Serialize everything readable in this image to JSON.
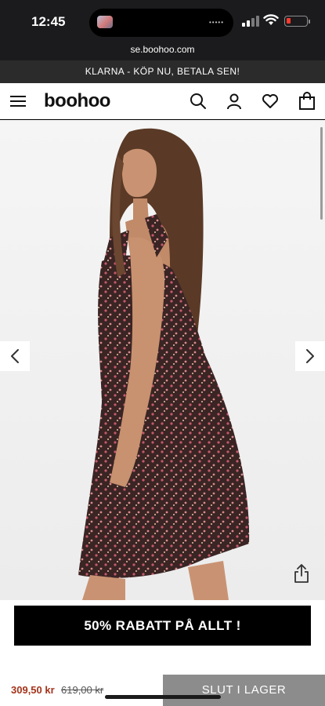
{
  "status_bar": {
    "time": "12:45",
    "island_dots": "•••••"
  },
  "browser": {
    "url": "se.boohoo.com"
  },
  "promo": {
    "text": "KLARNA - KÖP NU, BETALA SEN!"
  },
  "header": {
    "logo": "boohoo",
    "icons": [
      "menu-icon",
      "search-icon",
      "account-icon",
      "wishlist-heart-icon",
      "shopping-bag-icon"
    ]
  },
  "gallery": {
    "icons": [
      "chevron-left-icon",
      "chevron-right-icon",
      "share-icon"
    ]
  },
  "banner": {
    "text": "50% RABATT PÅ ALLT !"
  },
  "product": {
    "price": "309,50 kr",
    "original_price": "619,00 kr",
    "cta_label": "SLUT I LAGER"
  },
  "colors": {
    "sale_price": "#a4331a",
    "cta_bg": "#8c8c8c",
    "battery_low": "#ff3b30"
  }
}
